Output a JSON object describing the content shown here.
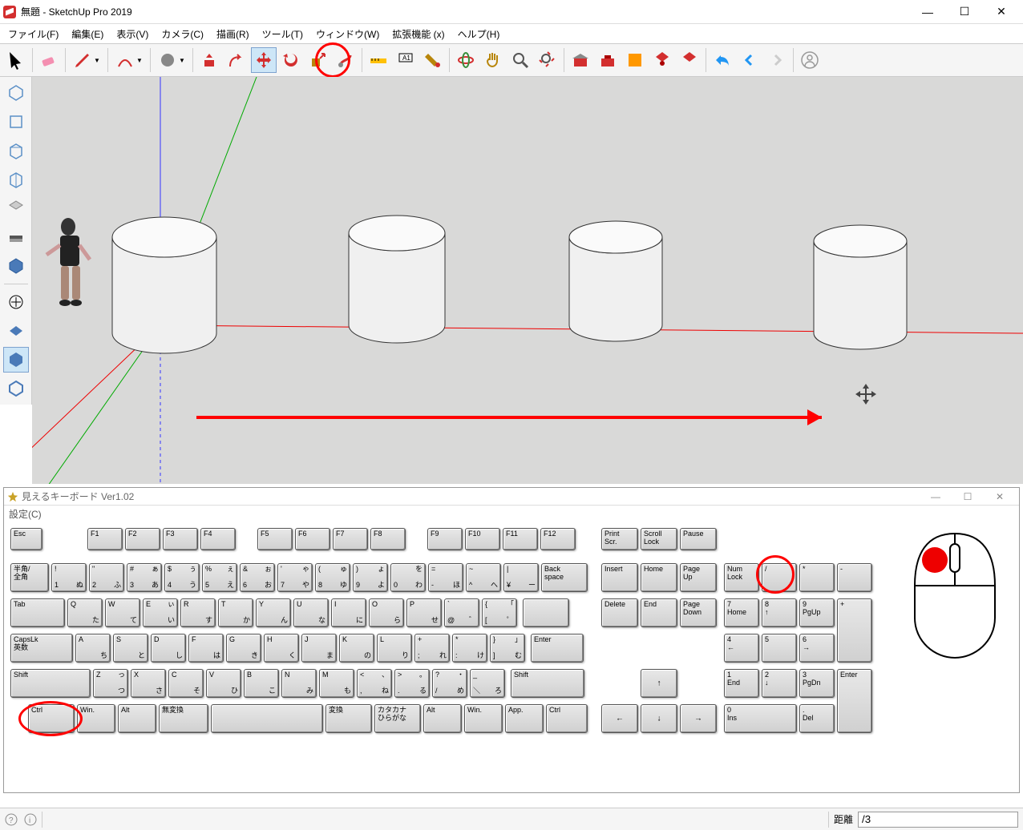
{
  "window": {
    "title": "無題 - SketchUp Pro 2019",
    "min_icon": "—",
    "max_icon": "☐",
    "close_icon": "✕"
  },
  "menu": {
    "file": "ファイル(F)",
    "edit": "編集(E)",
    "view": "表示(V)",
    "camera": "カメラ(C)",
    "draw": "描画(R)",
    "tools": "ツール(T)",
    "window": "ウィンドウ(W)",
    "extensions": "拡張機能 (x)",
    "help": "ヘルプ(H)"
  },
  "kbd": {
    "title": "見えるキーボード Ver1.02",
    "menu_settings": "設定(C)",
    "min": "—",
    "max": "☐",
    "close": "✕"
  },
  "keys": {
    "esc": "Esc",
    "f1": "F1",
    "f2": "F2",
    "f3": "F3",
    "f4": "F4",
    "f5": "F5",
    "f6": "F6",
    "f7": "F7",
    "f8": "F8",
    "f9": "F9",
    "f10": "F10",
    "f11": "F11",
    "f12": "F12",
    "print": "Print\nScr.",
    "scroll": "Scroll\nLock",
    "pause": "Pause",
    "hankaku": "半角/\n全角",
    "r1": [
      {
        "tl": "!",
        "bl": "1",
        "tr": "",
        "br": "ぬ"
      },
      {
        "tl": "\"",
        "bl": "2",
        "tr": "",
        "br": "ふ"
      },
      {
        "tl": "#",
        "bl": "3",
        "tr": "ぁ",
        "br": "あ"
      },
      {
        "tl": "$",
        "bl": "4",
        "tr": "ぅ",
        "br": "う"
      },
      {
        "tl": "%",
        "bl": "5",
        "tr": "ぇ",
        "br": "え"
      },
      {
        "tl": "&",
        "bl": "6",
        "tr": "ぉ",
        "br": "お"
      },
      {
        "tl": "'",
        "bl": "7",
        "tr": "ゃ",
        "br": "や"
      },
      {
        "tl": "(",
        "bl": "8",
        "tr": "ゅ",
        "br": "ゆ"
      },
      {
        "tl": ")",
        "bl": "9",
        "tr": "ょ",
        "br": "よ"
      },
      {
        "tl": "",
        "bl": "0",
        "tr": "を",
        "br": "わ"
      },
      {
        "tl": "=",
        "bl": "-",
        "tr": "",
        "br": "ほ"
      },
      {
        "tl": "~",
        "bl": "^",
        "tr": "",
        "br": "へ"
      },
      {
        "tl": "|",
        "bl": "¥",
        "tr": "",
        "br": "ー"
      }
    ],
    "backspace": "Back\nspace",
    "tab": "Tab",
    "r2": [
      {
        "tl": "Q",
        "br": "た"
      },
      {
        "tl": "W",
        "br": "て"
      },
      {
        "tl": "E",
        "tr": "ぃ",
        "br": "い"
      },
      {
        "tl": "R",
        "br": "す"
      },
      {
        "tl": "T",
        "br": "か"
      },
      {
        "tl": "Y",
        "br": "ん"
      },
      {
        "tl": "U",
        "br": "な"
      },
      {
        "tl": "I",
        "br": "に"
      },
      {
        "tl": "O",
        "br": "ら"
      },
      {
        "tl": "P",
        "br": "せ"
      },
      {
        "tl": "`",
        "bl": "@",
        "br": "゛"
      },
      {
        "tl": "{",
        "bl": "[",
        "tr": "「",
        "br": "゜"
      }
    ],
    "enter": "Enter",
    "caps": "CapsLk\n英数",
    "r3": [
      {
        "tl": "A",
        "br": "ち"
      },
      {
        "tl": "S",
        "br": "と"
      },
      {
        "tl": "D",
        "br": "し"
      },
      {
        "tl": "F",
        "br": "は"
      },
      {
        "tl": "G",
        "br": "き"
      },
      {
        "tl": "H",
        "br": "く"
      },
      {
        "tl": "J",
        "br": "ま"
      },
      {
        "tl": "K",
        "br": "の"
      },
      {
        "tl": "L",
        "br": "り"
      },
      {
        "tl": "+",
        "bl": ";",
        "br": "れ"
      },
      {
        "tl": "*",
        "bl": ":",
        "br": "け"
      },
      {
        "tl": "}",
        "bl": "]",
        "tr": "」",
        "br": "む"
      }
    ],
    "shift_l": "Shift",
    "r4": [
      {
        "tl": "Z",
        "tr": "っ",
        "br": "つ"
      },
      {
        "tl": "X",
        "br": "さ"
      },
      {
        "tl": "C",
        "br": "そ"
      },
      {
        "tl": "V",
        "br": "ひ"
      },
      {
        "tl": "B",
        "br": "こ"
      },
      {
        "tl": "N",
        "br": "み"
      },
      {
        "tl": "M",
        "br": "も"
      },
      {
        "tl": "<",
        "bl": ",",
        "tr": "、",
        "br": "ね"
      },
      {
        "tl": ">",
        "bl": ".",
        "tr": "。",
        "br": "る"
      },
      {
        "tl": "?",
        "bl": "/",
        "tr": "・",
        "br": "め"
      },
      {
        "tl": "_",
        "bl": "＼",
        "br": "ろ"
      }
    ],
    "shift_r": "Shift",
    "ctrl_l": "Ctrl",
    "win": "Win.",
    "alt_l": "Alt",
    "muhenkan": "無変換",
    "space": "",
    "henkan": "変換",
    "kana": "カタカナ\nひらがな",
    "alt_r": "Alt",
    "win_r": "Win.",
    "app": "App.",
    "ctrl_r": "Ctrl",
    "insert": "Insert",
    "home": "Home",
    "pgup": "Page\nUp",
    "delete": "Delete",
    "end": "End",
    "pgdn": "Page\nDown",
    "up": "↑",
    "left": "←",
    "down": "↓",
    "right": "→",
    "numlock": "Num\nLock",
    "divide": "/",
    "multiply": "*",
    "minus": "-",
    "num7": "7\nHome",
    "num8": "8\n↑",
    "num9": "9\nPgUp",
    "plus": "+",
    "num4": "4\n←",
    "num5": "5",
    "num6": "6\n→",
    "num1": "1\nEnd",
    "num2": "2\n↓",
    "num3": "3\nPgDn",
    "num_enter": "Enter",
    "num0": "0\nIns",
    "numdot": ".\nDel"
  },
  "status": {
    "measure_label": "距離",
    "measure_value": "/3"
  }
}
